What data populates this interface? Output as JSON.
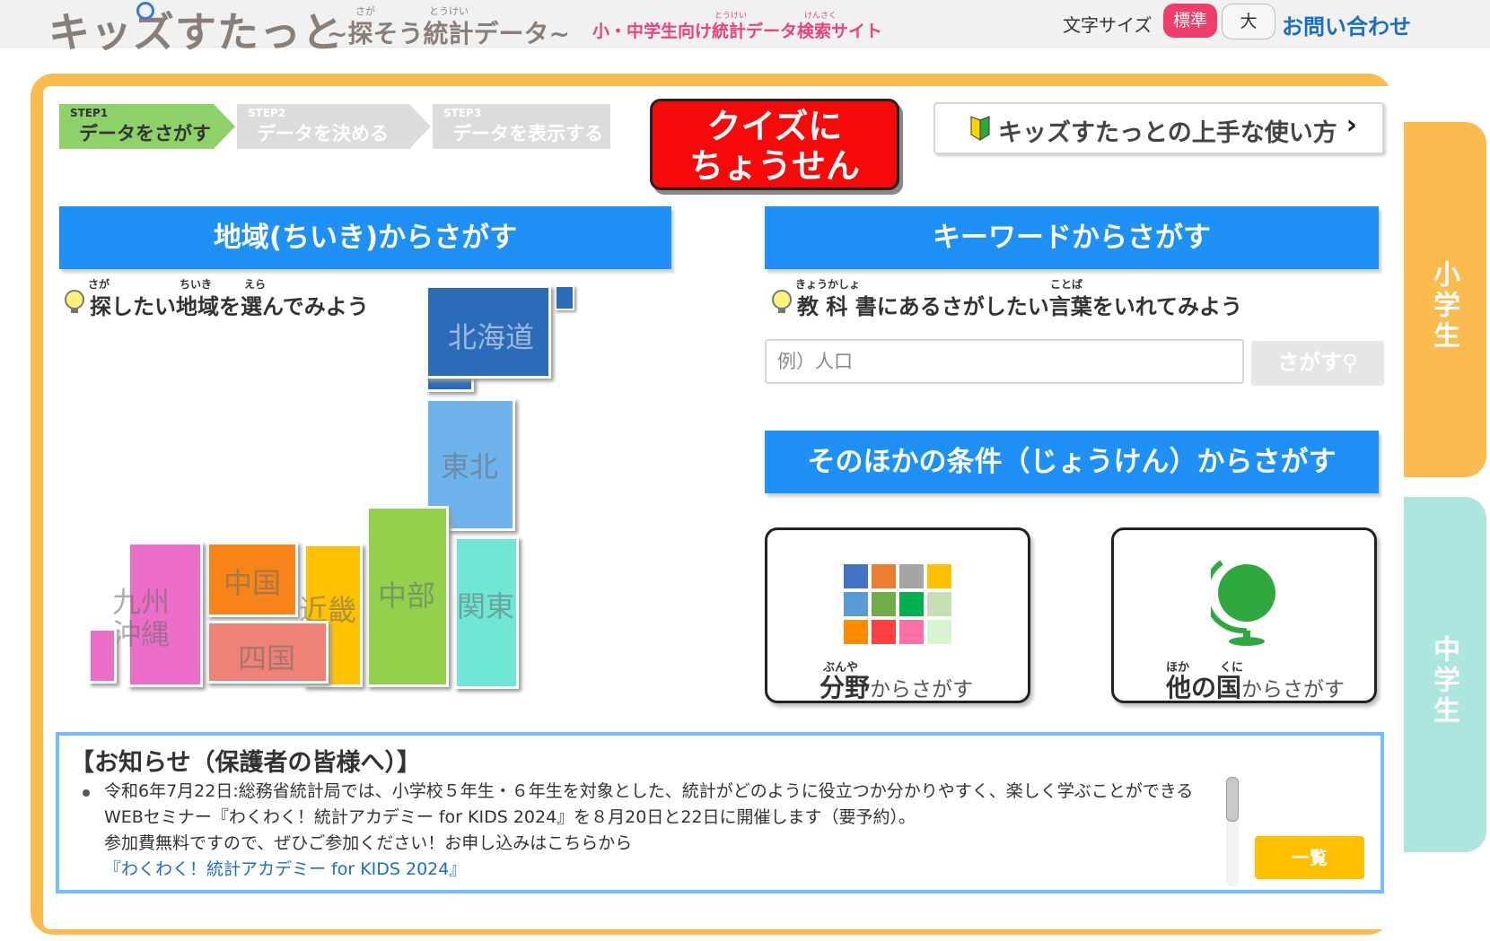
{
  "header": {
    "logo_main": "キッズすたっと",
    "logo_sub": "~探そう統計データ~",
    "logo_ruby_saga": "さが",
    "logo_ruby_toukei": "とうけい",
    "logo_tagline": "小・中学生向け統計データ検索サイト",
    "logo_tag_ruby1": "とうけい",
    "logo_tag_ruby2": "けんさく",
    "font_size_label": "文字サイズ",
    "font_size_normal": "標準",
    "font_size_large": "大",
    "contact": "お問い合わせ"
  },
  "side_tabs": {
    "elementary": "小学生",
    "junior": "中学生"
  },
  "steps": [
    {
      "num": "STEP1",
      "label": "データをさがす",
      "active": true
    },
    {
      "num": "STEP2",
      "label": "データを決める",
      "active": false
    },
    {
      "num": "STEP3",
      "label": "データを表示する",
      "active": false
    }
  ],
  "quiz_button": "クイズに\nちょうせん",
  "howto_button": "キッズすたっとの上手な使い方",
  "region_section": {
    "header": "地域(ちいき)からさがす",
    "hint": "探したい地域を選んでみよう",
    "hint_ruby": [
      "さが",
      "ちいき",
      "えら"
    ],
    "regions": {
      "hokkaido": "北海道",
      "tohoku": "東北",
      "kanto": "関東",
      "chubu": "中部",
      "kinki": "近畿",
      "chugoku": "中国",
      "shikoku": "四国",
      "kyushu": "九州\n沖縄"
    }
  },
  "keyword_section": {
    "header": "キーワードからさがす",
    "hint": "教 科 書にあるさがしたい言葉をいれてみよう",
    "hint_ruby": [
      "きょうかしょ",
      "ことば"
    ],
    "search_placeholder": "例）人口",
    "search_button": "さがす"
  },
  "other_section": {
    "header": "そのほかの条件（じょうけん）からさがす",
    "field": {
      "main": "分野",
      "rest": "からさがす",
      "ruby": "ぶんや"
    },
    "country": {
      "main": "他の国",
      "rest": "からさがす",
      "ruby1": "ほか",
      "ruby2": "くに"
    }
  },
  "colors": {
    "accent_blue": "#1e90f6",
    "frame_orange": "#fbbb4e",
    "junior_teal": "#ade6de",
    "quiz_red": "#f80909",
    "grid": [
      "#4472c4",
      "#ed7d31",
      "#a5a5a5",
      "#ffc000",
      "#5b9bd5",
      "#70ad47",
      "#00b050",
      "#c6e0b4",
      "#ff8c00",
      "#ff4040",
      "#ff6fa8",
      "#d8f5d0"
    ]
  },
  "notice": {
    "title": "【お知らせ（保護者の皆様へ）】",
    "line1": "令和6年7月22日:総務省統計局では、小学校５年生・６年生を対象とした、統計がどのように役立つか分かりやすく、楽しく学ぶことができるWEBセミナー『わくわく！統計アカデミー for KIDS 2024』を８月20日と22日に開催します（要予約）。",
    "line2": "参加費無料ですので、ぜひご参加ください！お申し込みはこちらから",
    "link": "『わくわく！統計アカデミー for KIDS 2024』",
    "list_button": "一覧"
  }
}
